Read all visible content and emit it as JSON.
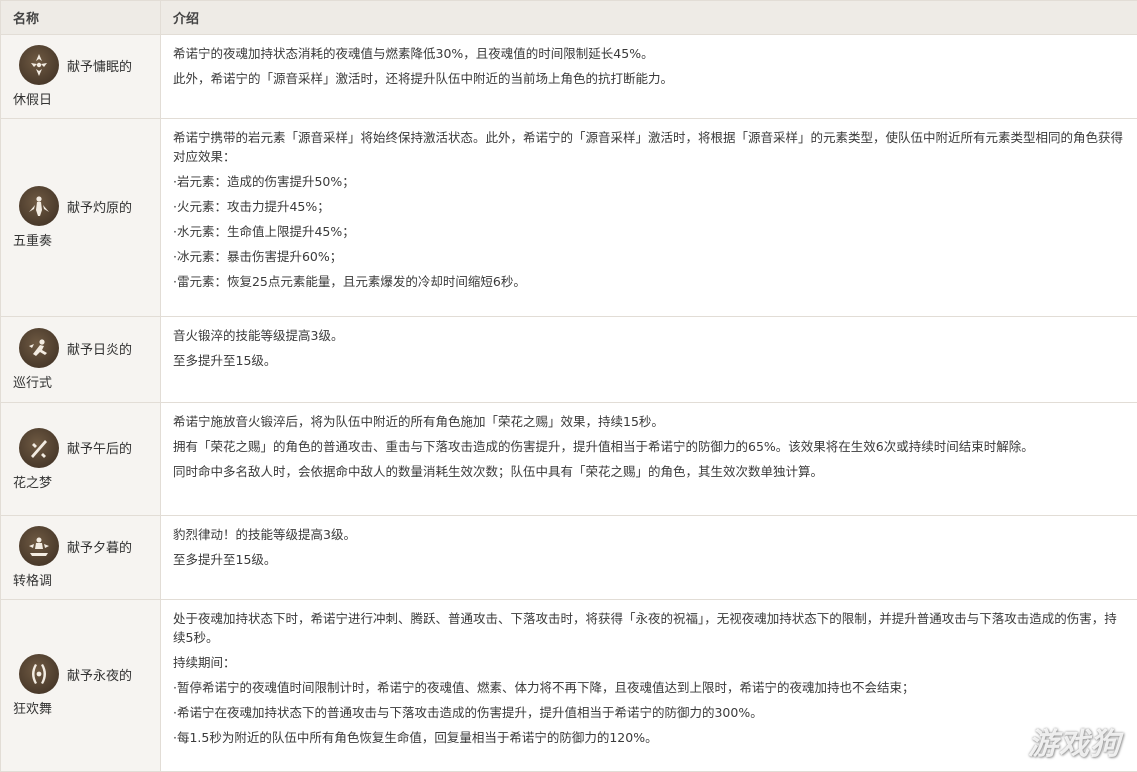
{
  "header": {
    "col_name": "名称",
    "col_desc": "介绍"
  },
  "rows": [
    {
      "name_line1": "献予慵眠的",
      "name_line2": "休假日",
      "icon": "constellation-1-icon",
      "lines": [
        "希诺宁的夜魂加持状态消耗的夜魂值与燃素降低30%，且夜魂值的时间限制延长45%。",
        "此外，希诺宁的「源音采样」激活时，还将提升队伍中附近的当前场上角色的抗打断能力。"
      ]
    },
    {
      "name_line1": "献予灼原的",
      "name_line2": "五重奏",
      "icon": "constellation-2-icon",
      "lines": [
        "希诺宁携带的岩元素「源音采样」将始终保持激活状态。此外，希诺宁的「源音采样」激活时，将根据「源音采样」的元素类型，使队伍中附近所有元素类型相同的角色获得对应效果：",
        "·岩元素：造成的伤害提升50%；",
        "·火元素：攻击力提升45%；",
        "·水元素：生命值上限提升45%；",
        "·冰元素：暴击伤害提升60%；",
        "·雷元素：恢复25点元素能量，且元素爆发的冷却时间缩短6秒。"
      ]
    },
    {
      "name_line1": "献予日炎的",
      "name_line2": "巡行式",
      "icon": "constellation-3-icon",
      "lines": [
        "音火锻淬的技能等级提高3级。",
        "至多提升至15级。"
      ]
    },
    {
      "name_line1": "献予午后的",
      "name_line2": "花之梦",
      "icon": "constellation-4-icon",
      "lines": [
        "希诺宁施放音火锻淬后，将为队伍中附近的所有角色施加「荣花之赐」效果，持续15秒。",
        "拥有「荣花之赐」的角色的普通攻击、重击与下落攻击造成的伤害提升，提升值相当于希诺宁的防御力的65%。该效果将在生效6次或持续时间结束时解除。",
        "同时命中多名敌人时，会依据命中敌人的数量消耗生效次数；队伍中具有「荣花之赐」的角色，其生效次数单独计算。"
      ]
    },
    {
      "name_line1": "献予夕暮的",
      "name_line2": "转格调",
      "icon": "constellation-5-icon",
      "lines": [
        "豹烈律动！的技能等级提高3级。",
        "至多提升至15级。"
      ]
    },
    {
      "name_line1": "献予永夜的",
      "name_line2": "狂欢舞",
      "icon": "constellation-6-icon",
      "lines": [
        "处于夜魂加持状态下时，希诺宁进行冲刺、腾跃、普通攻击、下落攻击时，将获得「永夜的祝福」，无视夜魂加持状态下的限制，并提升普通攻击与下落攻击造成的伤害，持续5秒。",
        "持续期间：",
        "·暂停希诺宁的夜魂值时间限制计时，希诺宁的夜魂值、燃素、体力将不再下降，且夜魂值达到上限时，希诺宁的夜魂加持也不会结束；",
        "·希诺宁在夜魂加持状态下的普通攻击与下落攻击造成的伤害提升，提升值相当于希诺宁的防御力的300%。",
        "·每1.5秒为附近的队伍中所有角色恢复生命值，回复量相当于希诺宁的防御力的120%。"
      ]
    }
  ],
  "watermark": "游戏狗"
}
